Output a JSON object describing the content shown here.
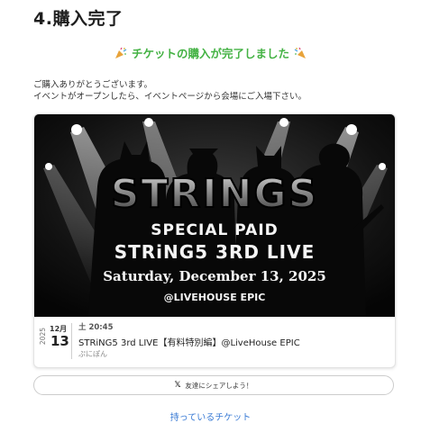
{
  "step_title": "4.購入完了",
  "complete_message": "チケットの購入が完了しました",
  "thanks_lines": [
    "ご購入ありがとうございます。",
    "イベントがオープンしたら、イベントページから会場にご入場下さい。"
  ],
  "banner": {
    "logo": "STRINGS",
    "line1": "SPECIAL PAID",
    "line2": "STRiNG5 3RD LIVE",
    "line3": "Saturday, December 13, 2025",
    "line4": "@LIVEHOUSE EPIC"
  },
  "event": {
    "year": "2025",
    "month": "12月",
    "day": "13",
    "time": "土 20:45",
    "title": "STRiNG5 3rd LIVE【有料特別編】@LiveHouse EPIC",
    "organizer": "ぷにぽん"
  },
  "share_button": {
    "icon": "x-logo-icon",
    "label": "友達にシェアしよう！"
  },
  "tickets_link": "持っているチケット",
  "colors": {
    "success_green": "#44b244",
    "link_blue": "#3a7bd5"
  }
}
